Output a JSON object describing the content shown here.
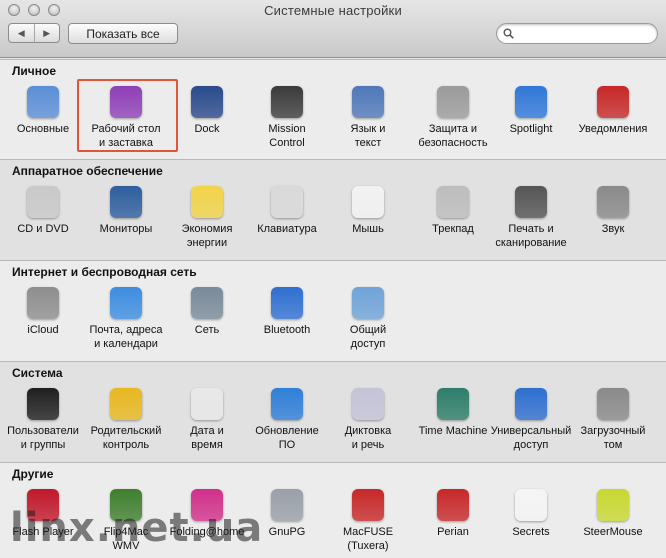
{
  "window": {
    "title": "Системные настройки"
  },
  "toolbar": {
    "back_glyph": "◀",
    "forward_glyph": "▶",
    "show_all_label": "Показать все",
    "search_placeholder": ""
  },
  "sections": [
    {
      "title": "Личное",
      "panes": [
        {
          "name": "general",
          "label": "Основные",
          "icon": "general-icon",
          "color": "#5b8ed6"
        },
        {
          "name": "desktop-screensaver",
          "label": "Рабочий стол\nи заставка",
          "icon": "desktop-icon",
          "color": "#8e3fb7",
          "highlighted": true
        },
        {
          "name": "dock",
          "label": "Dock",
          "icon": "dock-icon",
          "color": "#2a4a8c"
        },
        {
          "name": "mission-control",
          "label": "Mission\nControl",
          "icon": "mission-control-icon",
          "color": "#3b3b3b"
        },
        {
          "name": "language-text",
          "label": "Язык и\nтекст",
          "icon": "flag-icon",
          "color": "#4f78b8"
        },
        {
          "name": "security-privacy",
          "label": "Защита и\nбезопасность",
          "icon": "house-icon",
          "color": "#9b9b9b"
        },
        {
          "name": "spotlight",
          "label": "Spotlight",
          "icon": "magnifier-icon",
          "color": "#2f77d8"
        },
        {
          "name": "notifications",
          "label": "Уведомления",
          "icon": "notifications-icon",
          "color": "#c62828"
        }
      ]
    },
    {
      "title": "Аппаратное обеспечение",
      "panes": [
        {
          "name": "cd-dvd",
          "label": "CD и DVD",
          "icon": "disc-icon",
          "color": "#c9c9c9"
        },
        {
          "name": "displays",
          "label": "Мониторы",
          "icon": "display-icon",
          "color": "#2e5f9e"
        },
        {
          "name": "energy-saver",
          "label": "Экономия\nэнергии",
          "icon": "lightbulb-icon",
          "color": "#f2d34a"
        },
        {
          "name": "keyboard",
          "label": "Клавиатура",
          "icon": "keyboard-icon",
          "color": "#d9d9d9"
        },
        {
          "name": "mouse",
          "label": "Мышь",
          "icon": "mouse-icon",
          "color": "#f2f2f2"
        },
        {
          "name": "trackpad",
          "label": "Трекпад",
          "icon": "trackpad-icon",
          "color": "#bdbdbd"
        },
        {
          "name": "print-scan",
          "label": "Печать и\nсканирование",
          "icon": "printer-icon",
          "color": "#555555"
        },
        {
          "name": "sound",
          "label": "Звук",
          "icon": "speaker-icon",
          "color": "#8a8a8a"
        }
      ]
    },
    {
      "title": "Интернет и беспроводная сеть",
      "panes": [
        {
          "name": "icloud",
          "label": "iCloud",
          "icon": "cloud-icon",
          "color": "#8e8e8e"
        },
        {
          "name": "mail-contacts",
          "label": "Почта, адреса\nи календари",
          "icon": "at-icon",
          "color": "#3d8de0"
        },
        {
          "name": "network",
          "label": "Сеть",
          "icon": "globe-icon",
          "color": "#7a8a9a"
        },
        {
          "name": "bluetooth",
          "label": "Bluetooth",
          "icon": "bluetooth-icon",
          "color": "#2f6fd0"
        },
        {
          "name": "sharing",
          "label": "Общий\nдоступ",
          "icon": "folder-icon",
          "color": "#6fa3d8"
        }
      ]
    },
    {
      "title": "Система",
      "panes": [
        {
          "name": "users-groups",
          "label": "Пользователи\nи группы",
          "icon": "users-icon",
          "color": "#1f1f1f"
        },
        {
          "name": "parental-controls",
          "label": "Родительский\nконтроль",
          "icon": "parental-icon",
          "color": "#e8b820"
        },
        {
          "name": "date-time",
          "label": "Дата и\nвремя",
          "icon": "calendar-icon",
          "color": "#e8e8e8"
        },
        {
          "name": "software-update",
          "label": "Обновление\nПО",
          "icon": "update-icon",
          "color": "#2f7fd8"
        },
        {
          "name": "dictation-speech",
          "label": "Диктовка\nи речь",
          "icon": "microphone-icon",
          "color": "#c4c4d8"
        },
        {
          "name": "time-machine",
          "label": "Time Machine",
          "icon": "time-machine-icon",
          "color": "#2e7d6a"
        },
        {
          "name": "accessibility",
          "label": "Универсальный\nдоступ",
          "icon": "accessibility-icon",
          "color": "#2f6fd0"
        },
        {
          "name": "startup-disk",
          "label": "Загрузочный\nтом",
          "icon": "disk-icon",
          "color": "#8a8a8a"
        }
      ]
    },
    {
      "title": "Другие",
      "panes": [
        {
          "name": "flash-player",
          "label": "Flash Player",
          "icon": "flash-icon",
          "color": "#c0182b"
        },
        {
          "name": "flip4mac",
          "label": "Flip4Mac\nWMV",
          "icon": "wmv-icon",
          "color": "#3f7f2f"
        },
        {
          "name": "folding-home",
          "label": "Folding@home",
          "icon": "folding-icon",
          "color": "#d0308a"
        },
        {
          "name": "gnupg",
          "label": "GnuPG",
          "icon": "lock-icon",
          "color": "#9aa0a8"
        },
        {
          "name": "macfuse",
          "label": "MacFUSE\n(Tuxera)",
          "icon": "macfuse-icon",
          "color": "#c62828"
        },
        {
          "name": "perian",
          "label": "Perian",
          "icon": "perian-icon",
          "color": "#c62828"
        },
        {
          "name": "secrets",
          "label": "Secrets",
          "icon": "secrets-icon",
          "color": "#f4f4f4"
        },
        {
          "name": "steermouse",
          "label": "SteerMouse",
          "icon": "steermouse-icon",
          "color": "#c8d830"
        }
      ]
    }
  ],
  "watermark": "linx.net.ua"
}
